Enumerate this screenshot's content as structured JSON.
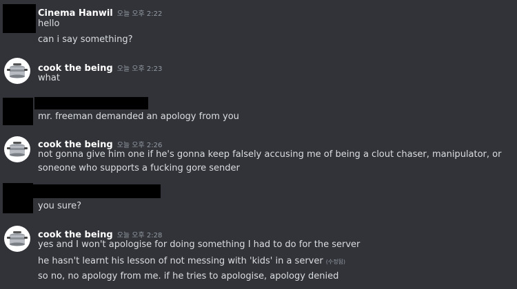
{
  "messages": {
    "m1": {
      "author": "Cinema Hanwil",
      "time": "오늘 오후 2:22",
      "lines": [
        "hello",
        "can i say something?"
      ]
    },
    "m2": {
      "author": "cook the being",
      "time": "오늘 오후 2:23",
      "lines": [
        "what"
      ]
    },
    "m3": {
      "lines": [
        "mr. freeman demanded an apology from you"
      ]
    },
    "m4": {
      "author": "cook the being",
      "time": "오늘 오후 2:26",
      "lines": [
        "not gonna give him one if he's gonna keep falsely accusing me of being a clout chaser, manipulator, or soneone who supports a fucking gore sender"
      ]
    },
    "m5": {
      "lines": [
        "you sure?"
      ]
    },
    "m6": {
      "author": "cook the being",
      "time": "오늘 오후 2:28",
      "lines": [
        "yes and I won't apologise for doing something I had to do for the server",
        "he hasn't learnt his lesson of not messing with 'kids' in a server",
        "so no, no apology from me. if he tries to apologise, apology denied"
      ],
      "edited_label": "(수정됨)"
    }
  },
  "icons": {
    "cook_avatar": "cooking-pot-icon"
  },
  "colors": {
    "background": "#313338",
    "author": "#ffffff",
    "text": "#dbdee1",
    "timestamp": "#949ba4",
    "redaction": "#000000"
  }
}
